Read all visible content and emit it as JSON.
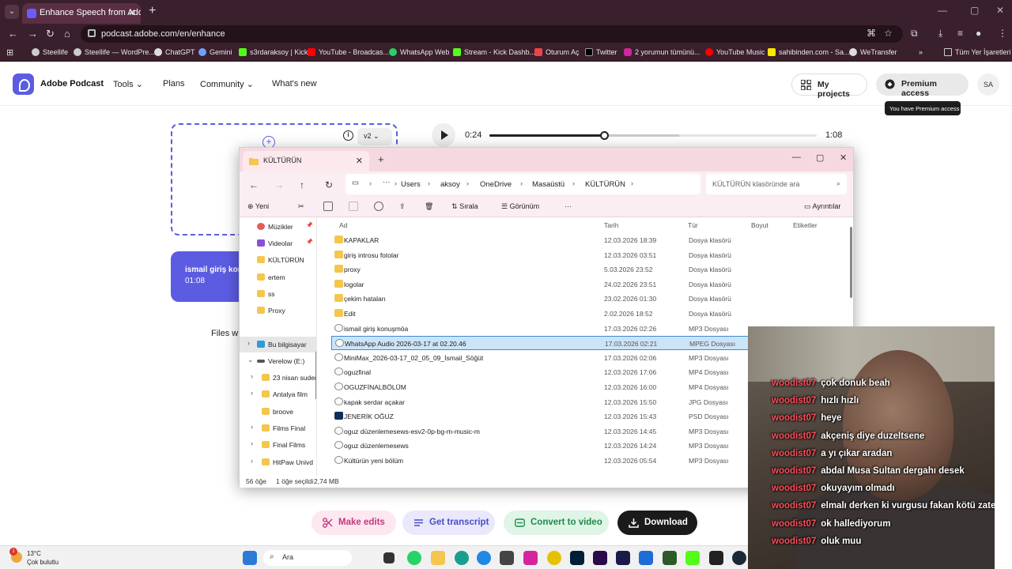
{
  "browser": {
    "tab_title": "Enhance Speech from Adobe | F",
    "url": "podcast.adobe.com/en/enhance",
    "bookmarks": [
      "Steellife",
      "Steellife — WordPre...",
      "ChatGPT",
      "Gemini",
      "s3rdaraksoy | Kick",
      "YouTube - Broadcas...",
      "WhatsApp Web",
      "Stream - Kick Dashb...",
      "Oturum Aç",
      "Twitter",
      "2 yorumun tümünü...",
      "YouTube Music",
      "sahibinden.com - Sa...",
      "WeTransfer"
    ],
    "bookmarks_all": "Tüm Yer İşaretleri"
  },
  "adobe": {
    "brand": "Adobe Podcast",
    "nav": [
      "Tools",
      "Plans",
      "Community",
      "What's new"
    ],
    "my_projects": "My projects",
    "premium": "Premium access",
    "avatar": "SA",
    "tooltip": "You have Premium access",
    "version": "v2",
    "time_current": "0:24",
    "time_total": "1:08",
    "playback_progress": 0.35,
    "file_name": "ismail giriş kon",
    "file_duration": "01:08",
    "files_note": "Files wil",
    "actions": [
      "Make edits",
      "Get transcript",
      "Convert to video",
      "Download"
    ]
  },
  "explorer": {
    "tab": "KÜLTÜRÜN",
    "breadcrumb": [
      "Users",
      "aksoy",
      "OneDrive",
      "Masaüstü",
      "KÜLTÜRÜN"
    ],
    "search_placeholder": "KÜLTÜRÜN klasöründe ara",
    "commands": {
      "new": "Yeni",
      "sort": "Sırala",
      "view": "Görünüm",
      "more": "···",
      "details": "Ayrıntılar"
    },
    "columns": {
      "name": "Ad",
      "date": "Tarih",
      "type": "Tür",
      "size": "Boyut",
      "tags": "Etiketler"
    },
    "sidebar": [
      {
        "label": "Müzikler",
        "pinned": true
      },
      {
        "label": "Videolar",
        "pinned": true
      },
      {
        "label": "KÜLTÜRÜN"
      },
      {
        "label": "ertem"
      },
      {
        "label": "ss"
      },
      {
        "label": "Proxy"
      },
      {
        "label": "Bu bilgisayar"
      },
      {
        "label": "Verelow (E:)"
      },
      {
        "label": "23 nisan suder"
      },
      {
        "label": "Antalya film"
      },
      {
        "label": "broove"
      },
      {
        "label": "Films Final"
      },
      {
        "label": "Final Films"
      },
      {
        "label": "HitPaw Univd"
      }
    ],
    "files": [
      {
        "name": "KAPAKLAR",
        "date": "12.03.2026 18:39",
        "type": "Dosya klasörü",
        "kind": "folder"
      },
      {
        "name": "giriş introsu fotolar",
        "date": "12.03.2026 03:51",
        "type": "Dosya klasörü",
        "kind": "folder"
      },
      {
        "name": "proxy",
        "date": "5.03.2026 23:52",
        "type": "Dosya klasörü",
        "kind": "folder"
      },
      {
        "name": "logolar",
        "date": "24.02.2026 23:51",
        "type": "Dosya klasörü",
        "kind": "folder"
      },
      {
        "name": "çekim hataları",
        "date": "23.02.2026 01:30",
        "type": "Dosya klasörü",
        "kind": "folder"
      },
      {
        "name": "Edit",
        "date": "2.02.2026 18:52",
        "type": "Dosya klasörü",
        "kind": "folder"
      },
      {
        "name": "ismail giriş konuşmöa",
        "date": "17.03.2026 02:26",
        "type": "MP3 Dosyası",
        "kind": "media"
      },
      {
        "name": "WhatsApp Audio 2026-03-17 at 02.20.46",
        "date": "17.03.2026 02:21",
        "type": "MPEG Dosyası",
        "kind": "media",
        "selected": true
      },
      {
        "name": "MiniMax_2026-03-17_02_05_09_İsmail_Söğüt",
        "date": "17.03.2026 02:06",
        "type": "MP3 Dosyası",
        "kind": "media"
      },
      {
        "name": "oguzfinal",
        "date": "12.03.2026 17:06",
        "type": "MP4 Dosyası",
        "kind": "media"
      },
      {
        "name": "OGUZFİNALBÖLÜM",
        "date": "12.03.2026 16:00",
        "type": "MP4 Dosyası",
        "kind": "media"
      },
      {
        "name": "kapak serdar açakar",
        "date": "12.03.2026 15:50",
        "type": "JPG Dosyası",
        "kind": "media"
      },
      {
        "name": "JENERİK OĞUZ",
        "date": "12.03.2026 15:43",
        "type": "PSD Dosyası",
        "kind": "psd"
      },
      {
        "name": "oguz düzenlemesews-esv2-0p-bg-m-music-m",
        "date": "12.03.2026 14:45",
        "type": "MP3 Dosyası",
        "kind": "media"
      },
      {
        "name": "oguz düzenlemesews",
        "date": "12.03.2026 14:24",
        "type": "MP3 Dosyası",
        "kind": "media"
      },
      {
        "name": "Kültürün yeni bölüm",
        "date": "12.03.2026 05:54",
        "type": "MP3 Dosyası",
        "kind": "media"
      }
    ],
    "status": {
      "count": "56 öğe",
      "selected": "1 öğe seçildi",
      "size": "2,74 MB"
    }
  },
  "chat": [
    {
      "user": "woodist07",
      "msg": "çok donuk beah"
    },
    {
      "user": "woodist07",
      "msg": "hızlı hızlı"
    },
    {
      "user": "woodist07",
      "msg": "heye"
    },
    {
      "user": "woodist07",
      "msg": "akçeniş diye duzeltsene"
    },
    {
      "user": "woodist07",
      "msg": "a yı çıkar aradan"
    },
    {
      "user": "woodist07",
      "msg": "abdal Musa Sultan dergahı desek"
    },
    {
      "user": "woodist07",
      "msg": "okuyayım olmadı"
    },
    {
      "user": "woodist07",
      "msg": "elmalı derken ki vurgusu fakan kötü zaten"
    },
    {
      "user": "woodist07",
      "msg": "ok hallediyorum"
    },
    {
      "user": "woodist07",
      "msg": "oluk muu"
    }
  ],
  "taskbar": {
    "temp": "13°C",
    "weather": "Çok bulutlu",
    "badge": "1",
    "search": "Ara"
  },
  "colors": {
    "accent": "#5b5ce2",
    "chat_user": "#ff4d5a",
    "browser_frame": "#3a1f2d"
  }
}
